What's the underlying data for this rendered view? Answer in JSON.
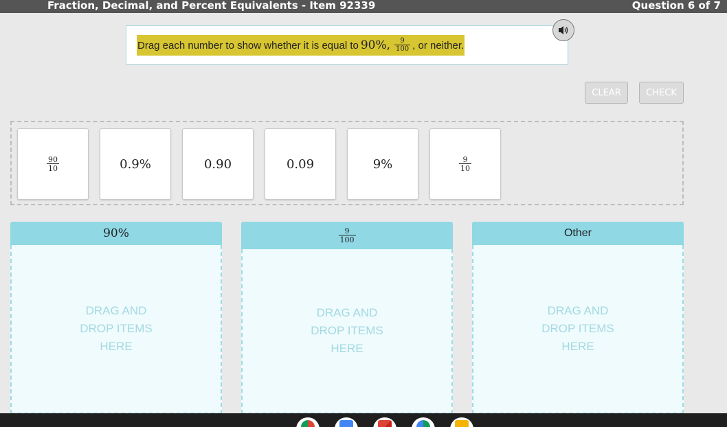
{
  "header": {
    "title": "Fraction, Decimal, and Percent Equivalents - Item 92339",
    "question_counter": "Question 6 of 7"
  },
  "prompt": {
    "text_before": "Drag each number to show whether it is equal to",
    "value_percent": "90%,",
    "fraction_num": "9",
    "fraction_den": "100",
    "text_after": ", or neither."
  },
  "controls": {
    "clear_label": "CLEAR",
    "check_label": "CHECK"
  },
  "tiles": [
    {
      "type": "fraction",
      "num": "90",
      "den": "10"
    },
    {
      "type": "text",
      "text": "0.9%"
    },
    {
      "type": "text",
      "text": "0.90"
    },
    {
      "type": "text",
      "text": "0.09"
    },
    {
      "type": "text",
      "text": "9%"
    },
    {
      "type": "fraction",
      "num": "9",
      "den": "10"
    }
  ],
  "bins": {
    "first": {
      "label": "90%",
      "placeholder": "DRAG AND DROP ITEMS HERE"
    },
    "second": {
      "num": "9",
      "den": "100",
      "placeholder": "DRAG AND DROP ITEMS HERE"
    },
    "third": {
      "label": "Other",
      "placeholder": "DRAG AND DROP ITEMS HERE"
    }
  },
  "colors": {
    "highlight": "#d7c531",
    "bin_header": "#8fd8e4",
    "bin_body": "#effbfc",
    "topbar": "#555555"
  },
  "taskbar": {
    "apps": [
      "chrome-icon",
      "docs-icon",
      "gmail-icon",
      "drive-icon",
      "sheets-icon"
    ]
  }
}
